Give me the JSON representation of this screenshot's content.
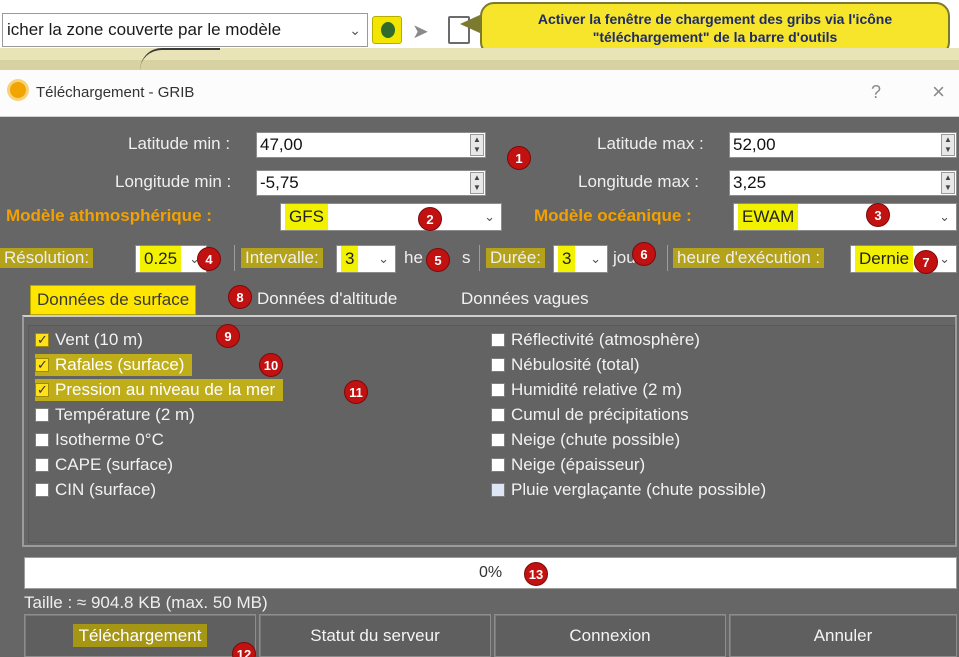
{
  "toolbar": {
    "zone_select_value": "icher la zone couverte par le modèle",
    "callout_line1": "Activer la fenêtre de chargement des gribs via l'icône",
    "callout_line2": "\"téléchargement\" de la barre d'outils"
  },
  "window": {
    "title": "Téléchargement - GRIB",
    "help": "?",
    "close": "×"
  },
  "coords": {
    "lat_min_label": "Latitude min :",
    "lat_min_value": "47,00",
    "lon_min_label": "Longitude min :",
    "lon_min_value": "-5,75",
    "lat_max_label": "Latitude max :",
    "lat_max_value": "52,00",
    "lon_max_label": "Longitude max :",
    "lon_max_value": "3,25"
  },
  "models": {
    "atmo_label": "Modèle athmosphérique :",
    "atmo_value": "GFS",
    "ocean_label": "Modèle océanique :",
    "ocean_value": "EWAM"
  },
  "settings": {
    "resolution_label": "Résolution:",
    "resolution_value": "0.25",
    "interval_label": "Intervalle:",
    "interval_value": "3",
    "interval_unit": "he",
    "interval_unit_tail": "s",
    "duration_label": "Durée:",
    "duration_value": "3",
    "duration_unit": "jou",
    "run_label": "heure d'exécution :",
    "run_value": "Dernie"
  },
  "tabs": [
    "Données de surface",
    "Données d'altitude",
    "Données vagues"
  ],
  "left_options": [
    {
      "label": "Vent (10 m)",
      "checked": true
    },
    {
      "label": "Rafales (surface)",
      "checked": true
    },
    {
      "label": "Pression au niveau de la mer",
      "checked": true
    },
    {
      "label": "Température (2 m)",
      "checked": false
    },
    {
      "label": "Isotherme 0°C",
      "checked": false
    },
    {
      "label": "CAPE (surface)",
      "checked": false
    },
    {
      "label": "CIN (surface)",
      "checked": false
    }
  ],
  "right_options": [
    {
      "label": "Réflectivité (atmosphère)",
      "checked": false
    },
    {
      "label": "Nébulosité (total)",
      "checked": false
    },
    {
      "label": "Humidité relative (2 m)",
      "checked": false
    },
    {
      "label": "Cumul de précipitations",
      "checked": false
    },
    {
      "label": "Neige (chute possible)",
      "checked": false
    },
    {
      "label": "Neige (épaisseur)",
      "checked": false
    },
    {
      "label": "Pluie verglaçante (chute possible)",
      "checked": false
    }
  ],
  "progress": {
    "value": 0,
    "text": "0%"
  },
  "size_text": "Taille : ≈ 904.8 KB (max. 50 MB)",
  "buttons": {
    "download": "Téléchargement",
    "server_status": "Statut du serveur",
    "connect": "Connexion",
    "cancel": "Annuler"
  },
  "badges": [
    "1",
    "2",
    "3",
    "4",
    "5",
    "6",
    "7",
    "8",
    "9",
    "10",
    "11",
    "12",
    "13"
  ],
  "colors": {
    "dialog_bg": "#666666",
    "highlight": "#f2f200",
    "model_label": "#f2a100",
    "badge": "#c21111",
    "callout": "#f6e52a"
  }
}
